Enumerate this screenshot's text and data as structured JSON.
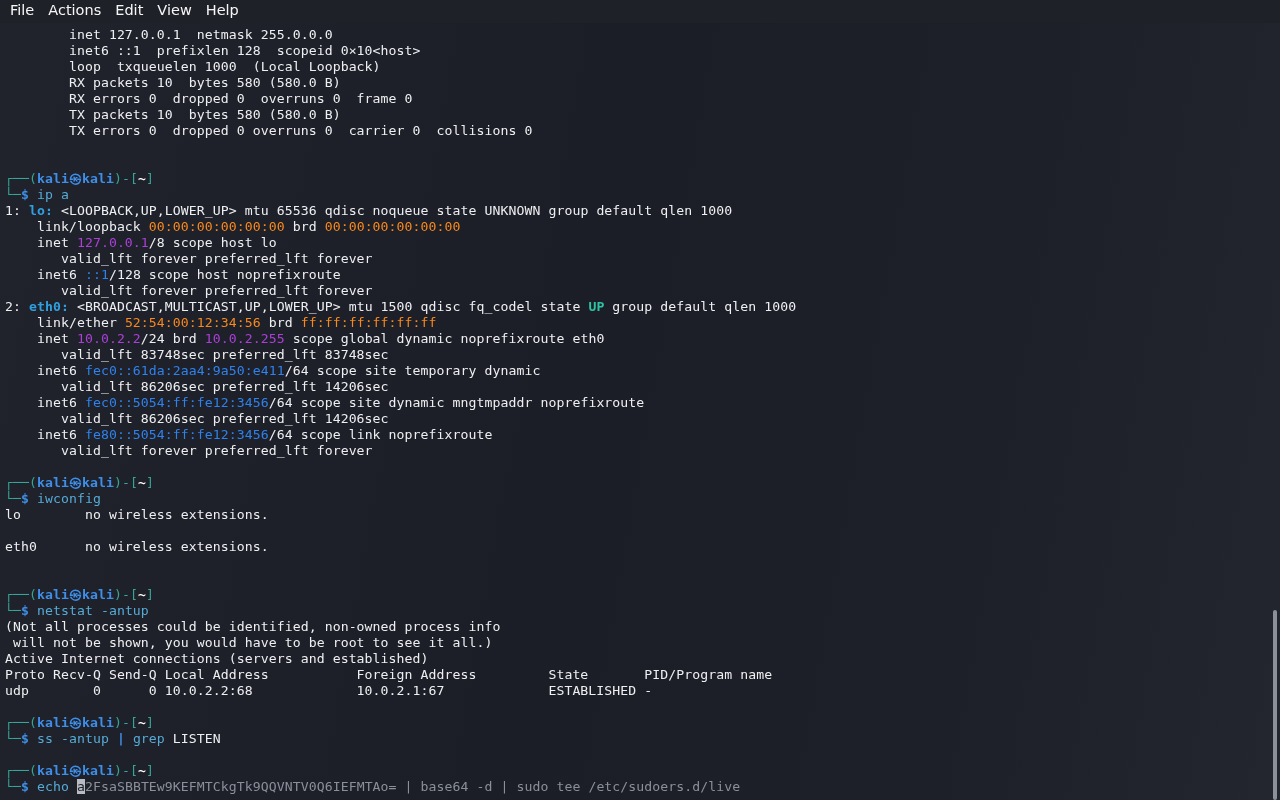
{
  "menu": [
    "File",
    "Actions",
    "Edit",
    "View",
    "Help"
  ],
  "terminal": {
    "lines": [
      {
        "kind": "output",
        "segments": [
          "        inet 127.0.0.1  netmask 255.0.0.0"
        ]
      },
      {
        "kind": "output",
        "segments": [
          "        inet6 ::1  prefixlen 128  scopeid 0×10<host>"
        ]
      },
      {
        "kind": "output",
        "segments": [
          "        loop  txqueuelen 1000  (Local Loopback)"
        ]
      },
      {
        "kind": "output",
        "segments": [
          "        RX packets 10  bytes 580 (580.0 B)"
        ]
      },
      {
        "kind": "output",
        "segments": [
          "        RX errors 0  dropped 0  overruns 0  frame 0"
        ]
      },
      {
        "kind": "output",
        "segments": [
          "        TX packets 10  bytes 580 (580.0 B)"
        ]
      },
      {
        "kind": "output",
        "segments": [
          "        TX errors 0  dropped 0 overruns 0  carrier 0  collisions 0"
        ]
      },
      {
        "kind": "blank"
      },
      {
        "kind": "blank"
      },
      {
        "kind": "prompt",
        "segments": [
          {
            "text": "┌──(",
            "kind": "frame"
          },
          {
            "text": "kali㉿kali",
            "kind": "user"
          },
          {
            "text": ")-[",
            "kind": "frame"
          },
          {
            "text": "~",
            "kind": "cwd"
          },
          {
            "text": "]",
            "kind": "frame"
          }
        ]
      },
      {
        "kind": "command",
        "segments": [
          {
            "text": "└─",
            "kind": "frame"
          },
          {
            "text": "$",
            "kind": "sigil"
          },
          {
            "text": " ip a",
            "kind": "cmd"
          }
        ]
      },
      {
        "kind": "output",
        "segments": [
          "1: ",
          {
            "text": "lo:",
            "kind": "iface"
          },
          " <LOOPBACK,UP,LOWER_UP> mtu 65536 qdisc noqueue state UNKNOWN group default qlen 1000"
        ]
      },
      {
        "kind": "output",
        "segments": [
          "    link/loopback ",
          {
            "text": "00:00:00:00:00:00",
            "kind": "mac"
          },
          " brd ",
          {
            "text": "00:00:00:00:00:00",
            "kind": "mac"
          }
        ]
      },
      {
        "kind": "output",
        "segments": [
          "    inet ",
          {
            "text": "127.0.0.1",
            "kind": "ipv4"
          },
          "/8 scope host lo"
        ]
      },
      {
        "kind": "output",
        "segments": [
          "       valid_lft forever preferred_lft forever"
        ]
      },
      {
        "kind": "output",
        "segments": [
          "    inet6 ",
          {
            "text": "::1",
            "kind": "ipv6"
          },
          "/128 scope host noprefixroute"
        ]
      },
      {
        "kind": "output",
        "segments": [
          "       valid_lft forever preferred_lft forever"
        ]
      },
      {
        "kind": "output",
        "segments": [
          "2: ",
          {
            "text": "eth0:",
            "kind": "iface"
          },
          " <BROADCAST,MULTICAST,UP,LOWER_UP> mtu 1500 qdisc fq_codel state ",
          {
            "text": "UP",
            "kind": "state"
          },
          " group default qlen 1000"
        ]
      },
      {
        "kind": "output",
        "segments": [
          "    link/ether ",
          {
            "text": "52:54:00:12:34:56",
            "kind": "mac"
          },
          " brd ",
          {
            "text": "ff:ff:ff:ff:ff:ff",
            "kind": "mac"
          }
        ]
      },
      {
        "kind": "output",
        "segments": [
          "    inet ",
          {
            "text": "10.0.2.2",
            "kind": "ipv4"
          },
          "/24 brd ",
          {
            "text": "10.0.2.255",
            "kind": "ipv4"
          },
          " scope global dynamic noprefixroute eth0"
        ]
      },
      {
        "kind": "output",
        "segments": [
          "       valid_lft 83748sec preferred_lft 83748sec"
        ]
      },
      {
        "kind": "output",
        "segments": [
          "    inet6 ",
          {
            "text": "fec0::61da:2aa4:9a50:e411",
            "kind": "ipv6"
          },
          "/64 scope site temporary dynamic"
        ]
      },
      {
        "kind": "output",
        "segments": [
          "       valid_lft 86206sec preferred_lft 14206sec"
        ]
      },
      {
        "kind": "output",
        "segments": [
          "    inet6 ",
          {
            "text": "fec0::5054:ff:fe12:3456",
            "kind": "ipv6"
          },
          "/64 scope site dynamic mngtmpaddr noprefixroute"
        ]
      },
      {
        "kind": "output",
        "segments": [
          "       valid_lft 86206sec preferred_lft 14206sec"
        ]
      },
      {
        "kind": "output",
        "segments": [
          "    inet6 ",
          {
            "text": "fe80::5054:ff:fe12:3456",
            "kind": "ipv6"
          },
          "/64 scope link noprefixroute"
        ]
      },
      {
        "kind": "output",
        "segments": [
          "       valid_lft forever preferred_lft forever"
        ]
      },
      {
        "kind": "blank"
      },
      {
        "kind": "prompt",
        "segments": [
          {
            "text": "┌──(",
            "kind": "frame"
          },
          {
            "text": "kali㉿kali",
            "kind": "user"
          },
          {
            "text": ")-[",
            "kind": "frame"
          },
          {
            "text": "~",
            "kind": "cwd"
          },
          {
            "text": "]",
            "kind": "frame"
          }
        ]
      },
      {
        "kind": "command",
        "segments": [
          {
            "text": "└─",
            "kind": "frame"
          },
          {
            "text": "$",
            "kind": "sigil"
          },
          {
            "text": " iwconfig",
            "kind": "cmd"
          }
        ]
      },
      {
        "kind": "output",
        "segments": [
          "lo        no wireless extensions."
        ]
      },
      {
        "kind": "blank"
      },
      {
        "kind": "output",
        "segments": [
          "eth0      no wireless extensions."
        ]
      },
      {
        "kind": "blank"
      },
      {
        "kind": "blank"
      },
      {
        "kind": "prompt",
        "segments": [
          {
            "text": "┌──(",
            "kind": "frame"
          },
          {
            "text": "kali㉿kali",
            "kind": "user"
          },
          {
            "text": ")-[",
            "kind": "frame"
          },
          {
            "text": "~",
            "kind": "cwd"
          },
          {
            "text": "]",
            "kind": "frame"
          }
        ]
      },
      {
        "kind": "command",
        "segments": [
          {
            "text": "└─",
            "kind": "frame"
          },
          {
            "text": "$",
            "kind": "sigil"
          },
          {
            "text": " netstat -antup",
            "kind": "cmd"
          }
        ]
      },
      {
        "kind": "output",
        "segments": [
          "(Not all processes could be identified, non-owned process info"
        ]
      },
      {
        "kind": "output",
        "segments": [
          " will not be shown, you would have to be root to see it all.)"
        ]
      },
      {
        "kind": "output",
        "segments": [
          "Active Internet connections (servers and established)"
        ]
      },
      {
        "kind": "output",
        "segments": [
          "Proto Recv-Q Send-Q Local Address           Foreign Address         State       PID/Program name"
        ]
      },
      {
        "kind": "output",
        "segments": [
          "udp        0      0 10.0.2.2:68             10.0.2.1:67             ESTABLISHED -"
        ]
      },
      {
        "kind": "blank"
      },
      {
        "kind": "prompt",
        "segments": [
          {
            "text": "┌──(",
            "kind": "frame"
          },
          {
            "text": "kali㉿kali",
            "kind": "user"
          },
          {
            "text": ")-[",
            "kind": "frame"
          },
          {
            "text": "~",
            "kind": "cwd"
          },
          {
            "text": "]",
            "kind": "frame"
          }
        ]
      },
      {
        "kind": "command",
        "segments": [
          {
            "text": "└─",
            "kind": "frame"
          },
          {
            "text": "$",
            "kind": "sigil"
          },
          {
            "text": " ss -antup",
            "kind": "cmd"
          },
          {
            "text": " |",
            "kind": "pipe"
          },
          {
            "text": " grep",
            "kind": "cmd"
          },
          " LISTEN"
        ]
      },
      {
        "kind": "blank"
      },
      {
        "kind": "prompt",
        "segments": [
          {
            "text": "┌──(",
            "kind": "frame"
          },
          {
            "text": "kali㉿kali",
            "kind": "user"
          },
          {
            "text": ")-[",
            "kind": "frame"
          },
          {
            "text": "~",
            "kind": "cwd"
          },
          {
            "text": "]",
            "kind": "frame"
          }
        ]
      },
      {
        "kind": "command",
        "segments": [
          {
            "text": "└─",
            "kind": "frame"
          },
          {
            "text": "$",
            "kind": "sigil"
          },
          {
            "text": " echo ",
            "kind": "cmd"
          },
          {
            "text": "a",
            "kind": "cursor"
          },
          {
            "text": "2FsaSBBTEw9KEFMTCkgTk9QQVNTV0Q6IEFMTAo= | base64 -d | sudo tee /etc/sudoers.d/live",
            "kind": "suggestion"
          }
        ]
      }
    ]
  }
}
